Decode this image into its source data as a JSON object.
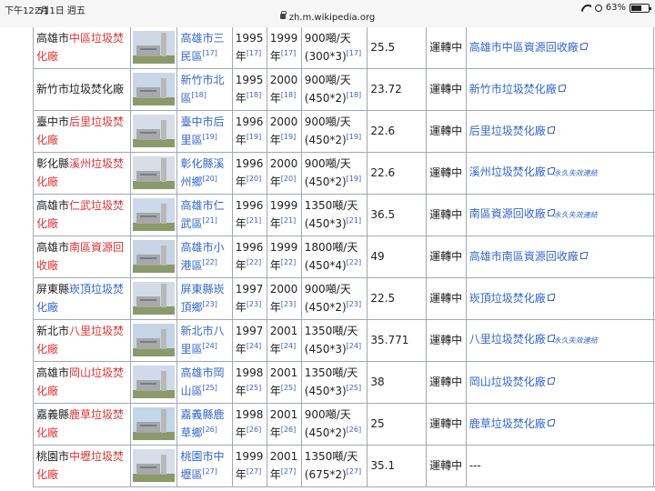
{
  "status_bar": {
    "time": "下午12:51",
    "date": "2月1日 週五",
    "url": "zh.m.wikipedia.org",
    "battery_percent": 63,
    "battery_label": "63%"
  },
  "archive_note": "永久失效連結",
  "rows": [
    {
      "name_pre": "高雄市",
      "name_link": "中區垃圾焚化廠",
      "name_link_color": "red",
      "loc": "高雄市三民區",
      "loc_ref": "[17]",
      "year_contract": "1995年",
      "year_contract_ref": "[17]",
      "year_op": "1999年",
      "year_op_ref": "[17]",
      "capacity": "900噸/天(300*3)",
      "capacity_ref": "[17]",
      "power": "25.5",
      "status": "運轉中",
      "link_text": "高雄市中區資源回收廠",
      "link_archived": false
    },
    {
      "name_pre": "新竹市垃圾焚化廠",
      "name_link": "",
      "name_link_color": "",
      "loc": "新竹市北區",
      "loc_ref": "[18]",
      "year_contract": "1995年",
      "year_contract_ref": "[18]",
      "year_op": "2000年",
      "year_op_ref": "[18]",
      "capacity": "900噸/天(450*2)",
      "capacity_ref": "[18]",
      "power": "23.72",
      "status": "運轉中",
      "link_text": "新竹市垃圾焚化廠",
      "link_archived": false
    },
    {
      "name_pre": "臺中市",
      "name_link": "后里垃圾焚化廠",
      "name_link_color": "red",
      "loc": "臺中市后里區",
      "loc_ref": "[19]",
      "year_contract": "1996年",
      "year_contract_ref": "[19]",
      "year_op": "2000年",
      "year_op_ref": "[19]",
      "capacity": "900噸/天(450*2)",
      "capacity_ref": "[19]",
      "power": "22.6",
      "status": "運轉中",
      "link_text": "后里垃圾焚化廠",
      "link_archived": false
    },
    {
      "name_pre": "彰化縣",
      "name_link": "溪州垃圾焚化廠",
      "name_link_color": "red",
      "loc": "彰化縣溪州鄉",
      "loc_ref": "[20]",
      "year_contract": "1996年",
      "year_contract_ref": "[20]",
      "year_op": "2000年",
      "year_op_ref": "[20]",
      "capacity": "900噸/天(450*2)",
      "capacity_ref": "[19]",
      "power": "22.6",
      "status": "運轉中",
      "link_text": "溪州垃圾焚化廠",
      "link_archived": true
    },
    {
      "name_pre": "高雄市",
      "name_link": "仁武垃圾焚化廠",
      "name_link_color": "red",
      "loc": "高雄市仁武區",
      "loc_ref": "[21]",
      "year_contract": "1996年",
      "year_contract_ref": "[21]",
      "year_op": "1999年",
      "year_op_ref": "[21]",
      "capacity": "1350噸/天(450*3)",
      "capacity_ref": "[21]",
      "power": "36.5",
      "status": "運轉中",
      "link_text": "南區資源回收廠",
      "link_archived": true
    },
    {
      "name_pre": "高雄市",
      "name_link": "南區資源回收廠",
      "name_link_color": "red",
      "loc": "高雄市小港區",
      "loc_ref": "[22]",
      "year_contract": "1996年",
      "year_contract_ref": "[22]",
      "year_op": "1999年",
      "year_op_ref": "[22]",
      "capacity": "1800噸/天(450*4)",
      "capacity_ref": "[22]",
      "power": "49",
      "status": "運轉中",
      "link_text": "高雄市南區資源回收廠",
      "link_archived": false
    },
    {
      "name_pre": "屏東縣",
      "name_link": "崁頂垃圾焚化廠",
      "name_link_color": "blue",
      "loc": "屏東縣崁頂鄉",
      "loc_ref": "[23]",
      "year_contract": "1997年",
      "year_contract_ref": "[23]",
      "year_op": "2000年",
      "year_op_ref": "[23]",
      "capacity": "900噸/天(450*2)",
      "capacity_ref": "[23]",
      "power": "22.5",
      "status": "運轉中",
      "link_text": "崁頂垃圾焚化廠",
      "link_archived": false
    },
    {
      "name_pre": "新北市",
      "name_link": "八里垃圾焚化廠",
      "name_link_color": "red",
      "loc": "新北市八里區",
      "loc_ref": "[24]",
      "year_contract": "1997年",
      "year_contract_ref": "[24]",
      "year_op": "2001年",
      "year_op_ref": "[24]",
      "capacity": "1350噸/天(450*3)",
      "capacity_ref": "[24]",
      "power": "35.771",
      "status": "運轉中",
      "link_text": "八里垃圾焚化廠",
      "link_archived": true
    },
    {
      "name_pre": "高雄市",
      "name_link": "岡山垃圾焚化廠",
      "name_link_color": "red",
      "loc": "高雄市岡山區",
      "loc_ref": "[25]",
      "year_contract": "1998年",
      "year_contract_ref": "[25]",
      "year_op": "2001年",
      "year_op_ref": "[25]",
      "capacity": "1350噸/天(450*3)",
      "capacity_ref": "[25]",
      "power": "38",
      "status": "運轉中",
      "link_text": "岡山垃圾焚化廠",
      "link_archived": false
    },
    {
      "name_pre": "嘉義縣",
      "name_link": "鹿草垃圾焚化廠",
      "name_link_color": "red",
      "loc": "嘉義縣鹿草鄉",
      "loc_ref": "[26]",
      "year_contract": "1998年",
      "year_contract_ref": "[26]",
      "year_op": "2001年",
      "year_op_ref": "[26]",
      "capacity": "900噸/天(450*2)",
      "capacity_ref": "[26]",
      "power": "25",
      "status": "運轉中",
      "link_text": "鹿草垃圾焚化廠",
      "link_archived": false
    },
    {
      "name_pre": "桃園市",
      "name_link": "中壢垃圾焚化廠",
      "name_link_color": "red",
      "loc": "桃園市中壢區",
      "loc_ref": "[27]",
      "year_contract": "1999年",
      "year_contract_ref": "[27]",
      "year_op": "2001年",
      "year_op_ref": "[27]",
      "capacity": "1350噸/天(675*2)",
      "capacity_ref": "[27]",
      "power": "35.1",
      "status": "運轉中",
      "link_text": "---",
      "link_archived": false,
      "link_plain": true
    }
  ]
}
